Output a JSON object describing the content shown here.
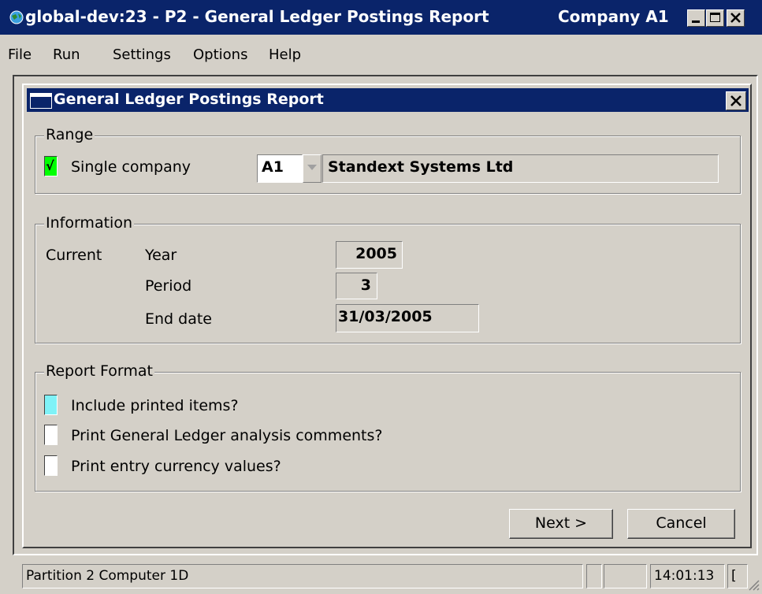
{
  "window": {
    "title": "global-dev:23 - P2 - General Ledger Postings Report",
    "company": "Company A1",
    "buttons": {
      "minimize": "_",
      "maximize": "□",
      "close": "×"
    }
  },
  "menu": {
    "items": [
      "File",
      "Run",
      "Settings",
      "Options",
      "Help"
    ]
  },
  "dialog": {
    "title": "General Ledger Postings Report",
    "close": "×",
    "range": {
      "label": "Range",
      "single_company_label": "Single company",
      "single_company_checked": true,
      "check_mark": "√",
      "company_code": "A1",
      "company_name": "Standext Systems Ltd"
    },
    "information": {
      "label": "Information",
      "current_label": "Current",
      "year_label": "Year",
      "year_value": "2005",
      "period_label": "Period",
      "period_value": "3",
      "end_date_label": "End date",
      "end_date_value": "31/03/2005"
    },
    "report_format": {
      "label": "Report Format",
      "include_printed": "Include printed items?",
      "print_analysis": "Print General Ledger analysis comments?",
      "print_currency": "Print entry currency values?"
    },
    "buttons": {
      "next": "Next >",
      "cancel": "Cancel"
    }
  },
  "status": {
    "partition": "Partition 2 Computer 1D",
    "time": "14:01:13",
    "extra": "["
  },
  "colors": {
    "title_bar": "#0a246a",
    "face": "#d4d0c8",
    "checked_green": "#00ff00",
    "focus_cyan": "#7ff2f7"
  }
}
